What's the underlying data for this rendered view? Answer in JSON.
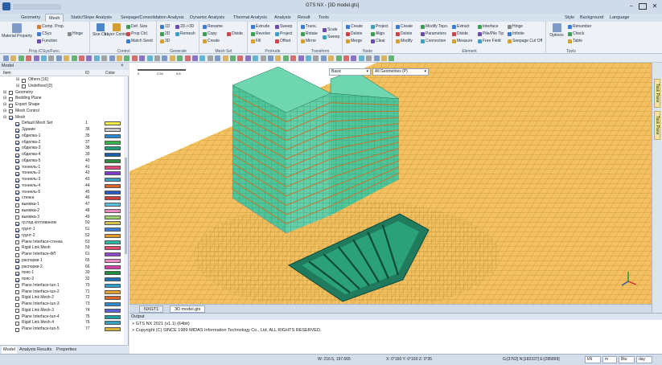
{
  "window": {
    "title": "GTS NX - [3D model.gts]"
  },
  "menu_tabs": [
    "Geometry",
    "Mesh",
    "Static/Slope Analysis",
    "Seepage/Consolidation Analysis",
    "Dynamic Analysis",
    "Thermal Analysis",
    "Analysis",
    "Result",
    "Tools"
  ],
  "menu_right": [
    "Style",
    "Background",
    "Language"
  ],
  "ribbon": {
    "groups": [
      {
        "label": "Prop./CSys/Func.",
        "items": [
          "Material Property",
          "Comp. Prop.",
          "CSys",
          "Function",
          "Hinge"
        ]
      },
      {
        "label": "Control",
        "items": [
          "Size Ctrl.",
          "Layer Control",
          "Def. Size",
          "Prop Ctrl.",
          "Match Seed"
        ]
      },
      {
        "label": "Generate",
        "items": [
          "1D",
          "2D",
          "3D",
          "2D->3D",
          "Remesh"
        ]
      },
      {
        "label": "Mesh Set",
        "items": [
          "Rename",
          "Copy",
          "Create",
          "Divide"
        ]
      },
      {
        "label": "Protrude",
        "items": [
          "Extrude",
          "Revolve",
          "Fill",
          "Sweep",
          "Project",
          "Offset"
        ]
      },
      {
        "label": "Transform",
        "items": [
          "Trans.",
          "Rotate",
          "Mirror",
          "Scale",
          "Sweep"
        ]
      },
      {
        "label": "Node",
        "items": [
          "Create",
          "Delete",
          "Merge",
          "Project",
          "Align",
          "Clear"
        ]
      },
      {
        "label": "Element",
        "items": [
          "Create",
          "Delete",
          "Modify",
          "Modify Topo.",
          "Parameters",
          "Connection",
          "Extract",
          "Divide",
          "Measure",
          "Interface",
          "Pile/Pile Tip",
          "Free Field",
          "Hinge",
          "Infinite",
          "Seepage Cut Off"
        ]
      },
      {
        "label": "Tools",
        "items": [
          "Options",
          "Renumber",
          "Check",
          "Table"
        ]
      }
    ]
  },
  "left_panel": {
    "title": "Model",
    "columns": [
      "Item",
      "ID",
      "Color"
    ],
    "rows": [
      {
        "label": "Others [16]",
        "id": "",
        "checked": false,
        "indent": 2,
        "color": ""
      },
      {
        "label": "Undefined [0]",
        "id": "",
        "checked": false,
        "indent": 2,
        "color": ""
      },
      {
        "label": "Geometry",
        "id": "",
        "checked": false,
        "indent": 0,
        "color": ""
      },
      {
        "label": "Bedding Plane",
        "id": "",
        "checked": false,
        "indent": 0,
        "color": ""
      },
      {
        "label": "Export Shape",
        "id": "",
        "checked": false,
        "indent": 0,
        "color": ""
      },
      {
        "label": "Mesh Control",
        "id": "",
        "checked": false,
        "indent": 0,
        "color": ""
      },
      {
        "label": "Mesh",
        "id": "",
        "checked": true,
        "indent": 0,
        "color": ""
      },
      {
        "label": "Default Mesh Set",
        "id": "1",
        "checked": true,
        "indent": 1,
        "color": "#f2ef47"
      },
      {
        "label": "Здание",
        "id": "36",
        "checked": true,
        "indent": 1,
        "color": "#c8c8c8"
      },
      {
        "label": "обделка-1",
        "id": "35",
        "checked": true,
        "indent": 1,
        "color": "#2a8ad6"
      },
      {
        "label": "обделка-2",
        "id": "37",
        "checked": true,
        "indent": 1,
        "color": "#39b54a"
      },
      {
        "label": "обделка-3",
        "id": "38",
        "checked": true,
        "indent": 1,
        "color": "#1e9e72"
      },
      {
        "label": "обделка-4",
        "id": "39",
        "checked": true,
        "indent": 1,
        "color": "#1b5fa8"
      },
      {
        "label": "обделка-5",
        "id": "40",
        "checked": true,
        "indent": 1,
        "color": "#2c8b3c"
      },
      {
        "label": "тоннель-1",
        "id": "41",
        "checked": true,
        "indent": 1,
        "color": "#e0457b"
      },
      {
        "label": "тоннель-2",
        "id": "42",
        "checked": true,
        "indent": 1,
        "color": "#7d3ccf"
      },
      {
        "label": "тоннель-3",
        "id": "43",
        "checked": true,
        "indent": 1,
        "color": "#3aa0c4"
      },
      {
        "label": "тоннель-4",
        "id": "44",
        "checked": true,
        "indent": 1,
        "color": "#d8642c"
      },
      {
        "label": "тоннель-5",
        "id": "45",
        "checked": true,
        "indent": 1,
        "color": "#2a59c8"
      },
      {
        "label": "стенка",
        "id": "46",
        "checked": true,
        "indent": 1,
        "color": "#cf3e3e"
      },
      {
        "label": "выемка-1",
        "id": "47",
        "checked": false,
        "indent": 1,
        "color": "#5bc1e0"
      },
      {
        "label": "выемка-2",
        "id": "48",
        "checked": false,
        "indent": 1,
        "color": "#f08ac4"
      },
      {
        "label": "выемка-3",
        "id": "49",
        "checked": false,
        "indent": 1,
        "color": "#9ad36a"
      },
      {
        "label": "гр.под котлованом",
        "id": "50",
        "checked": true,
        "indent": 1,
        "color": "#d4c14a"
      },
      {
        "label": "грунт-1",
        "id": "51",
        "checked": true,
        "indent": 1,
        "color": "#3c7fd9"
      },
      {
        "label": "грунт-2",
        "id": "52",
        "checked": true,
        "indent": 1,
        "color": "#e09b2c"
      },
      {
        "label": "Plane Interface-стенка",
        "id": "53",
        "checked": false,
        "indent": 1,
        "color": "#2eb8a4"
      },
      {
        "label": "Rigid Link Mesh",
        "id": "59",
        "checked": false,
        "indent": 1,
        "color": "#e54b6a"
      },
      {
        "label": "Plane Interface-ФЛ",
        "id": "61",
        "checked": false,
        "indent": 1,
        "color": "#8e49c9"
      },
      {
        "label": "распорки-1",
        "id": "65",
        "checked": true,
        "indent": 1,
        "color": "#f08ac4"
      },
      {
        "label": "распорки-2",
        "id": "66",
        "checked": true,
        "indent": 1,
        "color": "#d43fa8"
      },
      {
        "label": "пояс-1",
        "id": "30",
        "checked": true,
        "indent": 1,
        "color": "#1c8e3e"
      },
      {
        "label": "пояс-2",
        "id": "32",
        "checked": true,
        "indent": 1,
        "color": "#1d6fb8"
      },
      {
        "label": "Plane Interface-tun-1",
        "id": "70",
        "checked": false,
        "indent": 1,
        "color": "#2b9fc9"
      },
      {
        "label": "Plane Interface-tun-2",
        "id": "71",
        "checked": false,
        "indent": 1,
        "color": "#e6a030"
      },
      {
        "label": "Rigid Link Mesh-2",
        "id": "72",
        "checked": false,
        "indent": 1,
        "color": "#d8642c"
      },
      {
        "label": "Plane Interface-tun-3",
        "id": "73",
        "checked": false,
        "indent": 1,
        "color": "#2e8bd0"
      },
      {
        "label": "Rigid Link Mesh-3",
        "id": "74",
        "checked": false,
        "indent": 1,
        "color": "#5b5fd8"
      },
      {
        "label": "Plane Interface-tun-4",
        "id": "75",
        "checked": false,
        "indent": 1,
        "color": "#1e9ea0"
      },
      {
        "label": "Rigid Link Mesh-4",
        "id": "76",
        "checked": false,
        "indent": 1,
        "color": "#3aa0c4"
      },
      {
        "label": "Plane Interface-tun-5",
        "id": "77",
        "checked": false,
        "indent": 1,
        "color": "#d6b23a"
      }
    ],
    "tabs": [
      "Model",
      "Analysis",
      "Results",
      "Properties"
    ]
  },
  "viewport": {
    "display_mode": "Basic",
    "filter": "All Geometries (P)",
    "scale_ticks": [
      "0",
      "2.54",
      "4.8"
    ]
  },
  "view_tabs": [
    "NXGT1",
    "3D model.gts"
  ],
  "output": {
    "title": "Output",
    "lines": [
      "> GTS NX 2021 (v1.1) (64bit)",
      "> Copyright (C) SINCE 1989 MIDAS Information Technology Co., Ltd. ALL RIGHTS RESERVED."
    ]
  },
  "status": {
    "w": "W: 216.5, 197.665",
    "x": "X: 0°160  Y: 0°160  Z: 0°35",
    "g": "G:[3762] N:[182337] E:[285899]",
    "unit_force": "kN",
    "unit_length": "m",
    "unit_heat": "Btu",
    "unit_time": "day"
  },
  "right_strip": [
    "Task Pane",
    "Task Pane"
  ],
  "colors": {
    "accent": "#2a5ea8",
    "ground": "#f4c160",
    "mesh_green": "#4fc69a"
  }
}
